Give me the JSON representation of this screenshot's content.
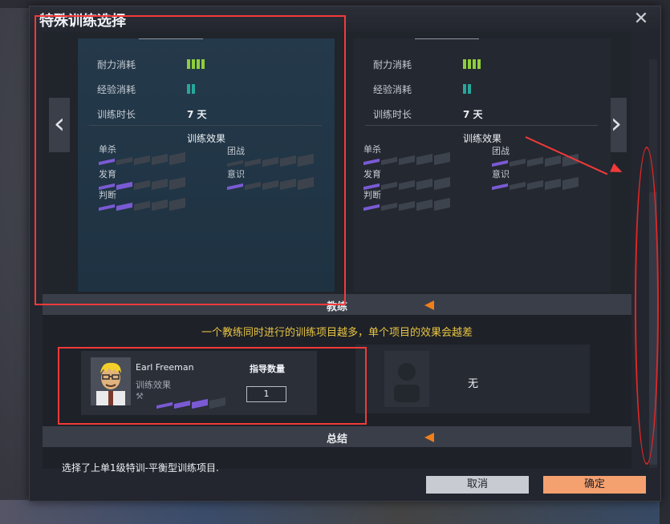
{
  "dialog": {
    "title": "特殊训练选择",
    "close_icon": "close-icon"
  },
  "carousel": {
    "prev_icon": "chevron-left-icon",
    "next_icon": "chevron-right-icon",
    "cards": [
      {
        "stamina_label": "耐力消耗",
        "stamina_level": 4,
        "exp_label": "经验消耗",
        "exp_level": 2,
        "duration_label": "训练时长",
        "duration_value": "7 天",
        "effects_title": "训练效果",
        "stats": [
          {
            "label": "单杀",
            "level": 1
          },
          {
            "label": "团战",
            "level": 0
          },
          {
            "label": "发育",
            "level": 2
          },
          {
            "label": "意识",
            "level": 1
          },
          {
            "label": "判断",
            "level": 2
          }
        ]
      },
      {
        "stamina_label": "耐力消耗",
        "stamina_level": 4,
        "exp_label": "经验消耗",
        "exp_level": 2,
        "duration_label": "训练时长",
        "duration_value": "7 天",
        "effects_title": "训练效果",
        "stats": [
          {
            "label": "单杀",
            "level": 1
          },
          {
            "label": "团战",
            "level": 1
          },
          {
            "label": "发育",
            "level": 1
          },
          {
            "label": "意识",
            "level": 1
          },
          {
            "label": "判断",
            "level": 1
          }
        ]
      }
    ]
  },
  "coach_section": {
    "label": "教练",
    "notice": "一个教练同时进行的训练项目越多，单个项目的效果会越差",
    "coach": {
      "name": "Earl Freeman",
      "effect_label": "训练效果",
      "count_label": "指导数量",
      "count_value": "1",
      "effect_level": 2
    },
    "empty_label": "无"
  },
  "summary_section": {
    "label": "总结",
    "text": "选择了上单1级特训-平衡型训练项目."
  },
  "buttons": {
    "cancel": "取消",
    "ok": "确定"
  },
  "colors": {
    "stamina_bar": "#8fce3b",
    "exp_bar": "#27a79b",
    "stat_on": "#7a5ad4",
    "section_triangle": "#f07f1a",
    "notice_text": "#e8c543",
    "annotation": "#f23a3a"
  }
}
